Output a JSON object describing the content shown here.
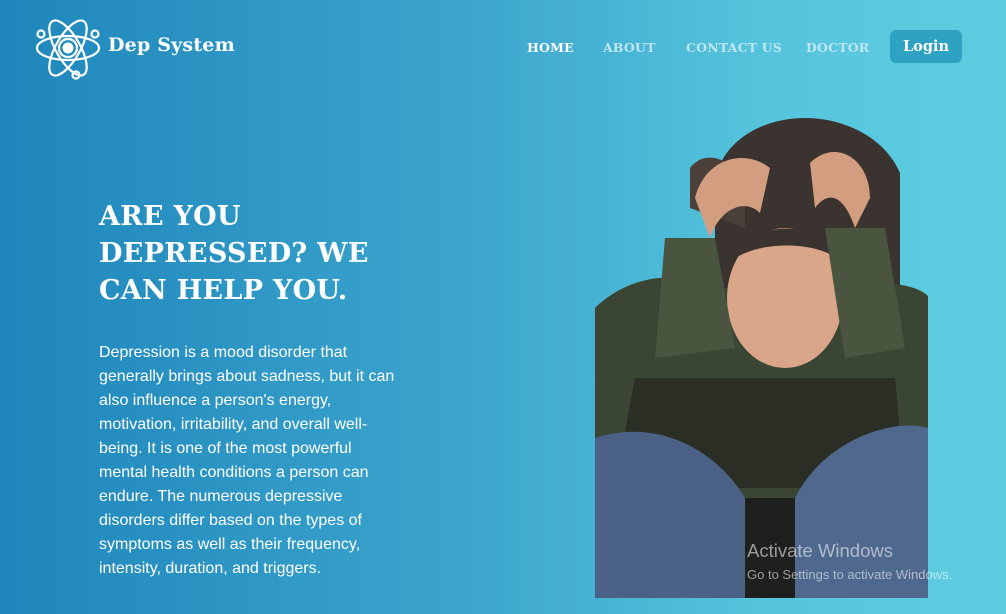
{
  "brand": {
    "name": "Dep System",
    "logo_icon": "atom-icon"
  },
  "nav": {
    "items": [
      {
        "label": "HOME",
        "active": true
      },
      {
        "label": "ABOUT",
        "active": false
      },
      {
        "label": "CONTACT US",
        "active": false
      },
      {
        "label": "DOCTOR",
        "active": false
      }
    ],
    "login_label": "Login"
  },
  "hero": {
    "title": "ARE YOU DEPRESSED? WE CAN HELP YOU.",
    "description": "Depression is a mood disorder that generally brings about sadness, but it can also influence a person's energy, motivation, irritability, and overall well-being. It is one of the most powerful mental health conditions a person can endure. The numerous depressive disorders differ based on the types of symptoms as well as their frequency, intensity, duration, and triggers."
  },
  "watermark": {
    "title": "Activate Windows",
    "subtitle": "Go to Settings to activate Windows."
  },
  "colors": {
    "gradient_start": "#1f86bb",
    "gradient_end": "#5fcde0",
    "login_button": "#2ea2c3",
    "nav_inactive": "#bfe6f3"
  }
}
